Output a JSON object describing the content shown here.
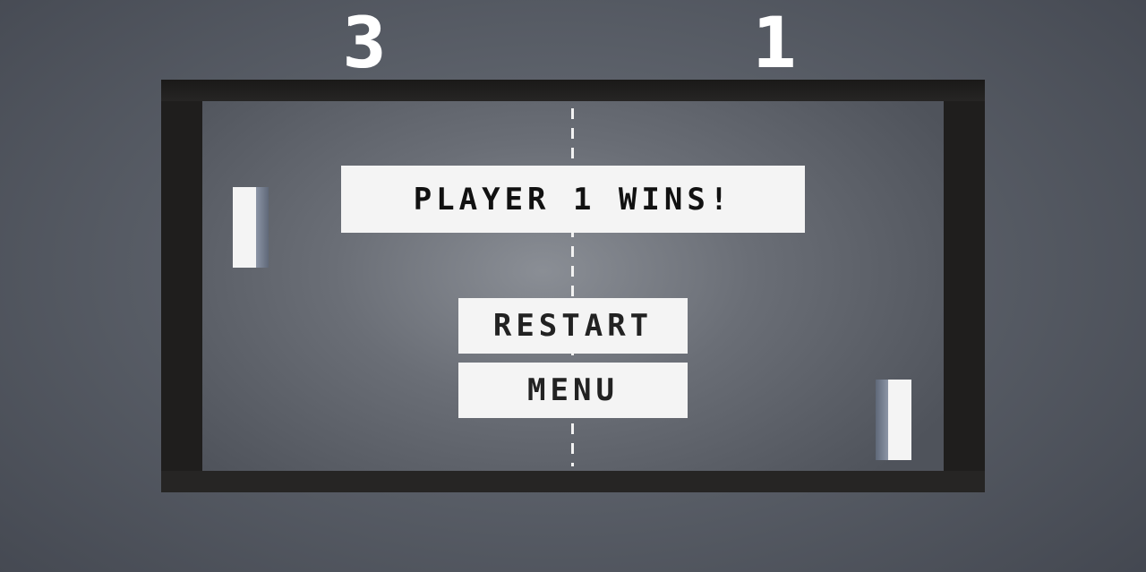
{
  "scoreboard": {
    "left_score": "3",
    "right_score": "1"
  },
  "result_banner": {
    "text": "PLAYER 1 WINS!"
  },
  "menu": {
    "restart_label": "RESTART",
    "menu_label": "MENU"
  },
  "colors": {
    "background": "#4b4f57",
    "frame": "#1f1e1d",
    "paddle": "#f4f4f4",
    "panel": "#f4f4f4",
    "text": "#111111"
  }
}
